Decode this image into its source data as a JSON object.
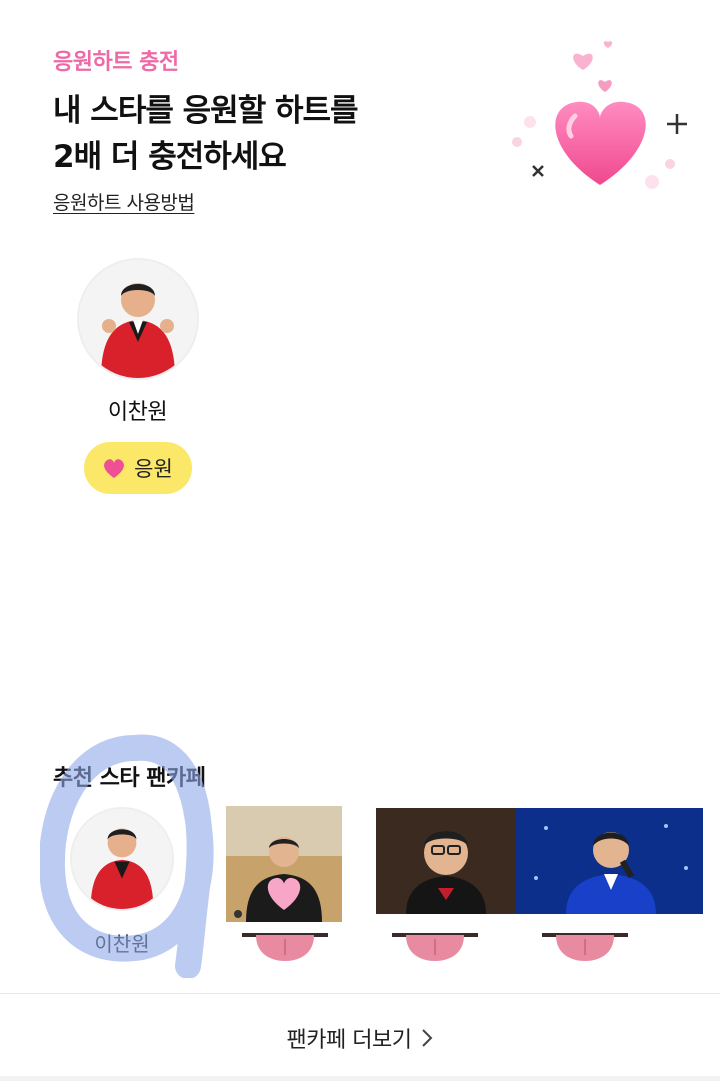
{
  "hero": {
    "eyebrow": "응원하트 충전",
    "headline_line1": "내 스타를 응원할 하트를",
    "headline_line2": "2배 더 충전하세요",
    "how_to_link": "응원하트 사용방법",
    "art_icon": "hearts-illustration"
  },
  "star": {
    "name": "이찬원",
    "avatar_icon": "star-avatar",
    "cheer_label": "응원",
    "cheer_icon": "heart-icon"
  },
  "recommended": {
    "title": "추천 스타 팬카페",
    "items": [
      {
        "name": "이찬원",
        "icon": "star-avatar"
      },
      {
        "name": "",
        "icon": "fan-photo-thumbnail"
      },
      {
        "name": "",
        "icon": "stage-photo-thumbnail"
      },
      {
        "name": "",
        "icon": "concert-photo-thumbnail"
      }
    ]
  },
  "footer": {
    "more_label": "팬카페 더보기",
    "more_icon": "chevron-right-icon"
  },
  "colors": {
    "accent_pink": "#ee6aa7",
    "cheer_yellow": "#fbe869",
    "scribble_blue": "#8fa8e8"
  }
}
